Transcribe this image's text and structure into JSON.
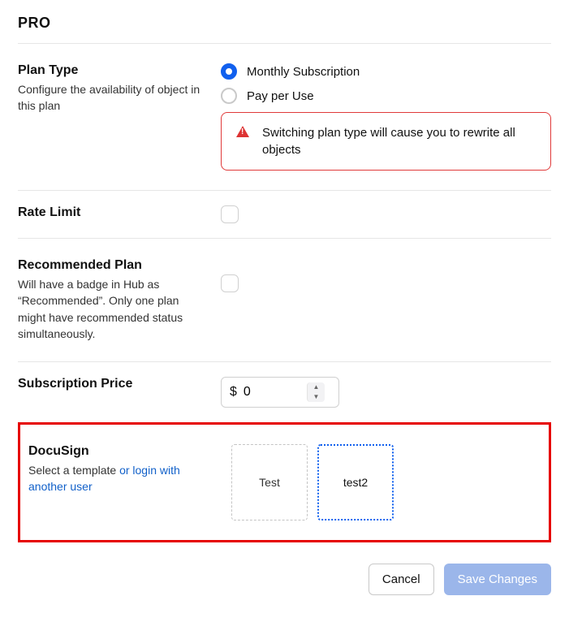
{
  "header": {
    "title": "PRO"
  },
  "plan_type": {
    "label": "Plan Type",
    "desc": "Configure the availability of object in this plan",
    "options": {
      "monthly": "Monthly Subscription",
      "payperuse": "Pay per Use"
    },
    "warning": "Switching plan type will cause you to rewrite all objects"
  },
  "rate_limit": {
    "label": "Rate Limit"
  },
  "recommended": {
    "label": "Recommended Plan",
    "desc": "Will have a badge in Hub as “Recommended”. Only one plan might have recommended status simultaneously."
  },
  "price": {
    "label": "Subscription Price",
    "currency": "$",
    "value": "0"
  },
  "docusign": {
    "label": "DocuSign",
    "desc_prefix": "Select a template ",
    "link": "or login with another user",
    "templates": {
      "t1": "Test",
      "t2": "test2"
    }
  },
  "footer": {
    "cancel": "Cancel",
    "save": "Save Changes"
  }
}
